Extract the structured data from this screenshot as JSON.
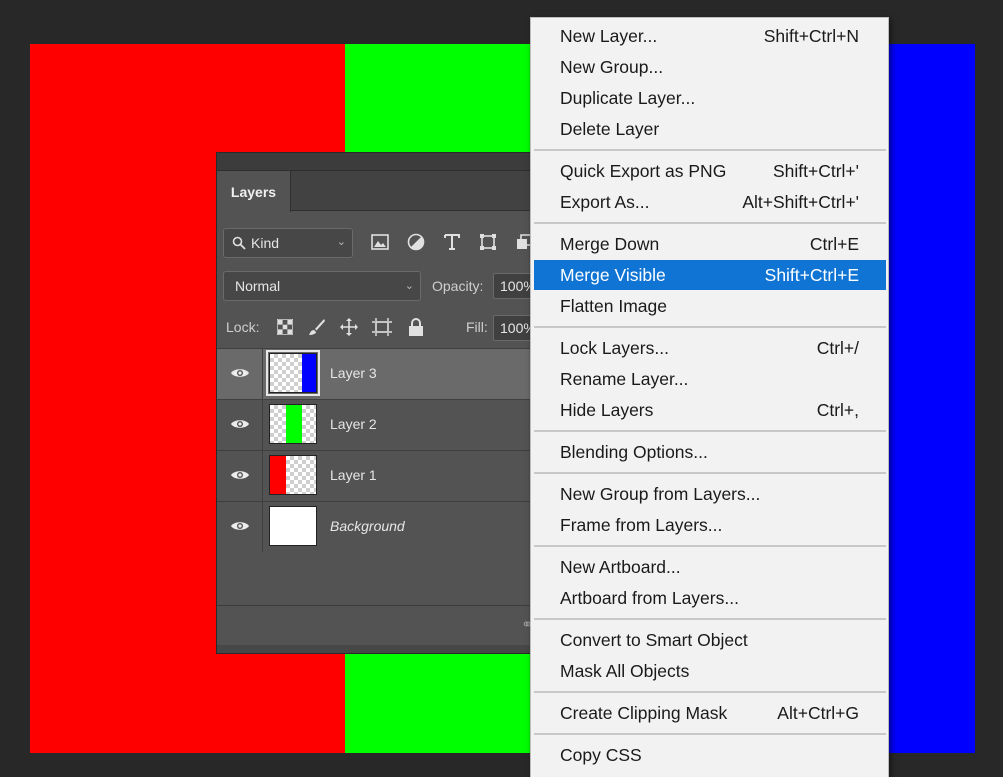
{
  "canvas": {
    "stripes": [
      "#ff0000",
      "#00ff00",
      "#0000ff"
    ]
  },
  "layers_panel": {
    "tab_label": "Layers",
    "filter": {
      "kind_label": "Kind",
      "icons": [
        "image-filter-icon",
        "adjustment-filter-icon",
        "type-filter-icon",
        "shape-filter-icon",
        "smart-object-filter-icon"
      ]
    },
    "blend_mode": "Normal",
    "opacity_label": "Opacity:",
    "opacity_value": "100%",
    "lock_label": "Lock:",
    "fill_label": "Fill:",
    "fill_value": "100%",
    "layers": [
      {
        "name": "Layer 3",
        "selected": true,
        "thumb": "blue-right"
      },
      {
        "name": "Layer 2",
        "selected": false,
        "thumb": "green-middle"
      },
      {
        "name": "Layer 1",
        "selected": false,
        "thumb": "red-left"
      },
      {
        "name": "Background",
        "selected": false,
        "thumb": "white",
        "italic": true
      }
    ]
  },
  "context_menu": {
    "highlight_color": "#0f74d3",
    "groups": [
      [
        {
          "label": "New Layer...",
          "shortcut": "Shift+Ctrl+N"
        },
        {
          "label": "New Group...",
          "shortcut": ""
        },
        {
          "label": "Duplicate Layer...",
          "shortcut": ""
        },
        {
          "label": "Delete Layer",
          "shortcut": ""
        }
      ],
      [
        {
          "label": "Quick Export as PNG",
          "shortcut": "Shift+Ctrl+'"
        },
        {
          "label": "Export As...",
          "shortcut": "Alt+Shift+Ctrl+'"
        }
      ],
      [
        {
          "label": "Merge Down",
          "shortcut": "Ctrl+E"
        },
        {
          "label": "Merge Visible",
          "shortcut": "Shift+Ctrl+E",
          "highlighted": true
        },
        {
          "label": "Flatten Image",
          "shortcut": ""
        }
      ],
      [
        {
          "label": "Lock Layers...",
          "shortcut": "Ctrl+/"
        },
        {
          "label": "Rename Layer...",
          "shortcut": ""
        },
        {
          "label": "Hide Layers",
          "shortcut": "Ctrl+,"
        }
      ],
      [
        {
          "label": "Blending Options...",
          "shortcut": ""
        }
      ],
      [
        {
          "label": "New Group from Layers...",
          "shortcut": ""
        },
        {
          "label": "Frame from Layers...",
          "shortcut": ""
        }
      ],
      [
        {
          "label": "New Artboard...",
          "shortcut": ""
        },
        {
          "label": "Artboard from Layers...",
          "shortcut": ""
        }
      ],
      [
        {
          "label": "Convert to Smart Object",
          "shortcut": ""
        },
        {
          "label": "Mask All Objects",
          "shortcut": ""
        }
      ],
      [
        {
          "label": "Create Clipping Mask",
          "shortcut": "Alt+Ctrl+G"
        }
      ],
      [
        {
          "label": "Copy CSS",
          "shortcut": ""
        }
      ]
    ]
  }
}
